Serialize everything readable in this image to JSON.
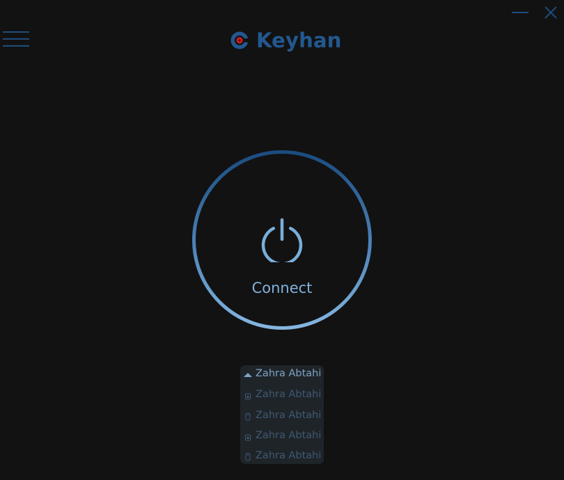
{
  "app": {
    "name": "Keyhan"
  },
  "window_controls": {
    "minimize": "minimize-icon",
    "close": "close-icon"
  },
  "menu": {
    "icon": "hamburger-menu-icon"
  },
  "connect_button": {
    "label": "Connect",
    "icon": "power-icon"
  },
  "accounts": [
    {
      "name": "Zahra Abtahi",
      "icon": "caret-up-icon",
      "state": "selected"
    },
    {
      "name": "Zahra Abtahi",
      "icon": "sim-card-icon",
      "state": "inactive"
    },
    {
      "name": "Zahra Abtahi",
      "icon": "usb-key-icon",
      "state": "inactive"
    },
    {
      "name": "Zahra Abtahi",
      "icon": "sim-card-icon",
      "state": "inactive"
    },
    {
      "name": "Zahra Abtahi",
      "icon": "usb-key-icon",
      "state": "inactive"
    }
  ],
  "colors": {
    "background": "#121213",
    "brand": "#23588e",
    "accent_light": "#82b2dc",
    "logo_red": "#d01c1c",
    "list_bg": "#1f2429"
  }
}
